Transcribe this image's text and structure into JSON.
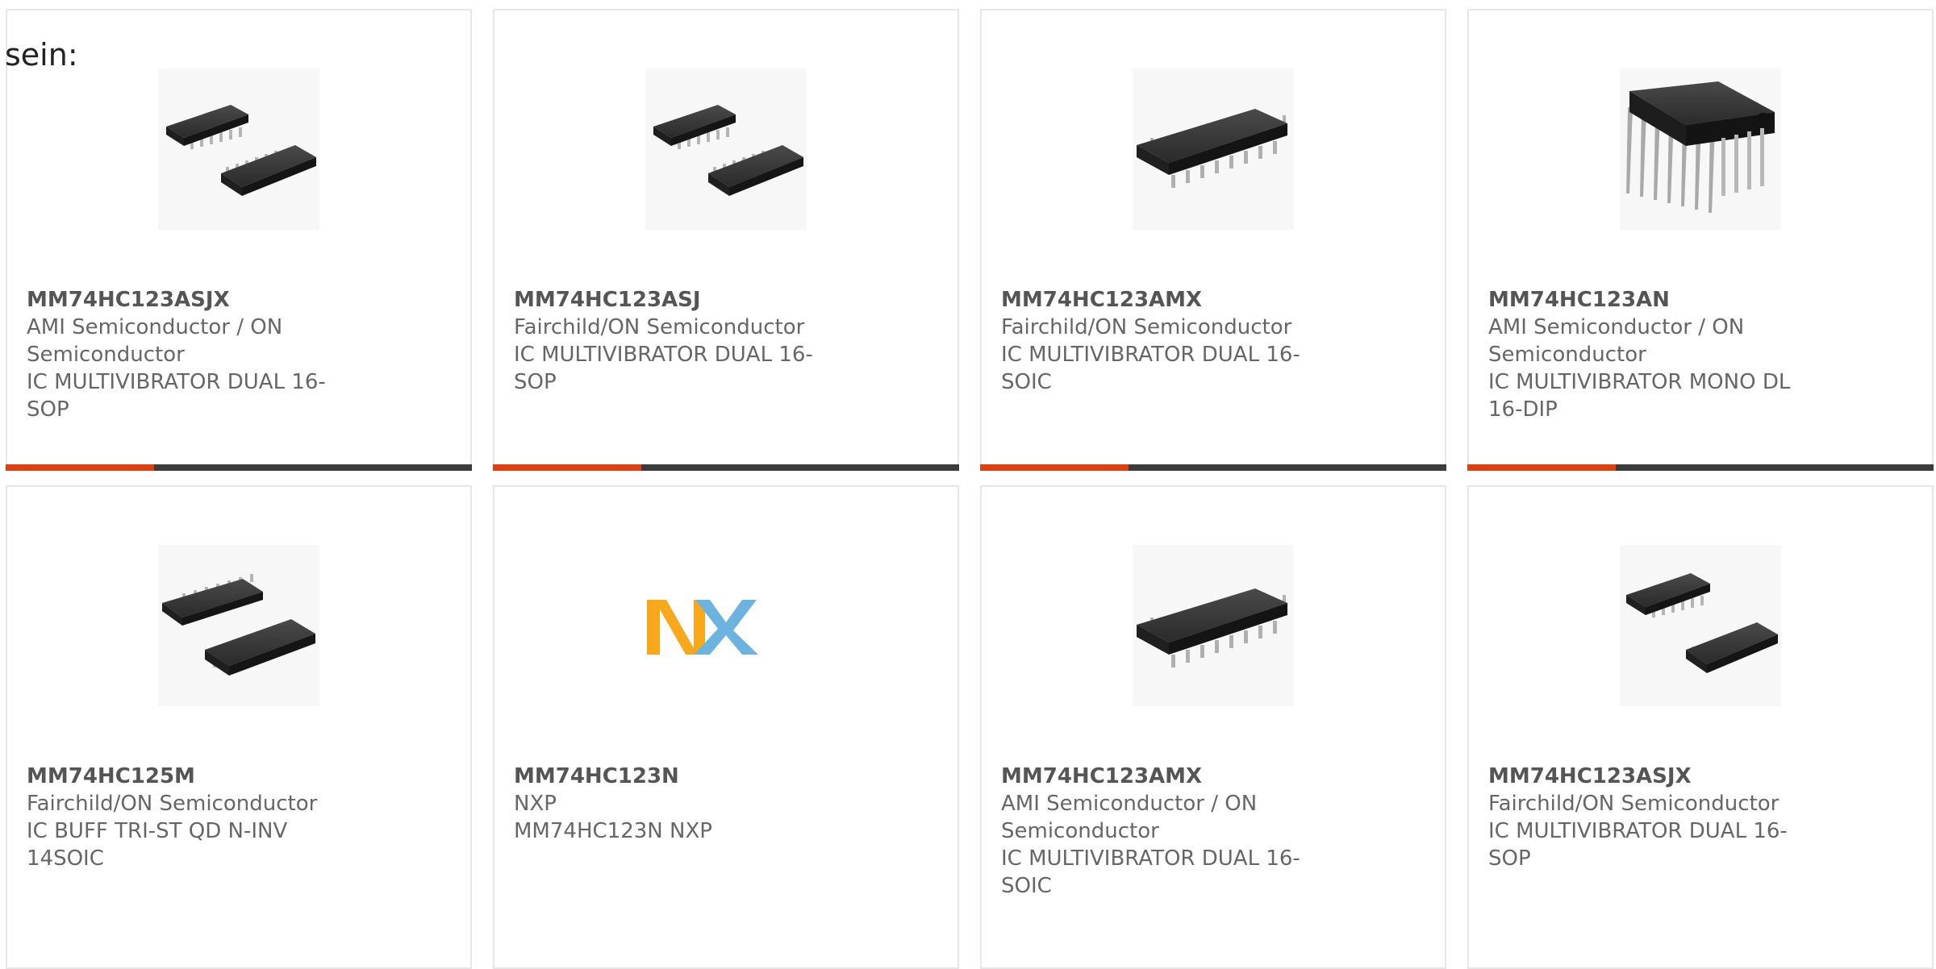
{
  "intro_text": "sein:",
  "colors": {
    "accent": "#e0400f",
    "bar": "#3c3c3c",
    "border": "#e6e6e6",
    "text": "#666666"
  },
  "cards": [
    {
      "part": "MM74HC123ASJX",
      "manufacturer": "AMI Semiconductor / ON Semiconductor",
      "description": "IC MULTIVIBRATOR DUAL 16-SOP",
      "image": "sop-chip-pair"
    },
    {
      "part": "MM74HC123ASJ",
      "manufacturer": "Fairchild/ON Semiconductor",
      "description": "IC MULTIVIBRATOR DUAL 16-SOP",
      "image": "sop-chip-pair"
    },
    {
      "part": "MM74HC123AMX",
      "manufacturer": "Fairchild/ON Semiconductor",
      "description": "IC MULTIVIBRATOR DUAL 16-SOIC",
      "image": "soic-chip"
    },
    {
      "part": "MM74HC123AN",
      "manufacturer": "AMI Semiconductor / ON Semiconductor",
      "description": "IC MULTIVIBRATOR MONO DL 16-DIP",
      "image": "dip-chip"
    },
    {
      "part": "MM74HC125M",
      "manufacturer": "Fairchild/ON Semiconductor",
      "description": "IC BUFF TRI-ST QD N-INV 14SOIC",
      "image": "sop-chip-pair"
    },
    {
      "part": "MM74HC123N",
      "manufacturer": "NXP",
      "description": "MM74HC123N NXP",
      "image": "nxp-logo",
      "logo_text": "NXP"
    },
    {
      "part": "MM74HC123AMX",
      "manufacturer": "AMI Semiconductor / ON Semiconductor",
      "description": "IC MULTIVIBRATOR DUAL 16-SOIC",
      "image": "soic-chip"
    },
    {
      "part": "MM74HC123ASJX",
      "manufacturer": "Fairchild/ON Semiconductor",
      "description": "IC MULTIVIBRATOR DUAL 16-SOP",
      "image": "sop-chip-pair"
    }
  ]
}
